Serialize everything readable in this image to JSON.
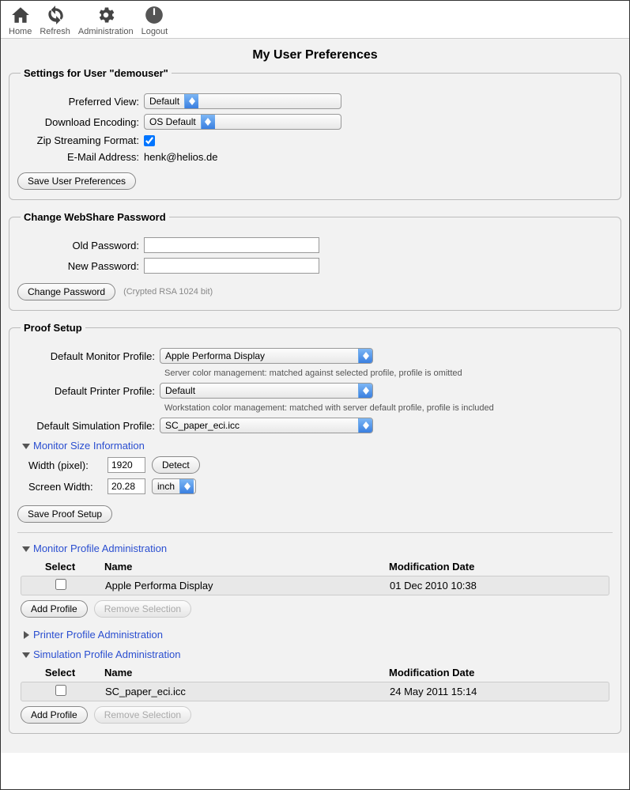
{
  "toolbar": {
    "home": "Home",
    "refresh": "Refresh",
    "administration": "Administration",
    "logout": "Logout"
  },
  "page_title": "My User Preferences",
  "settings": {
    "legend": "Settings for User \"demouser\"",
    "preferred_view_label": "Preferred View:",
    "preferred_view_value": "Default",
    "download_encoding_label": "Download Encoding:",
    "download_encoding_value": "OS Default",
    "zip_streaming_label": "Zip Streaming Format:",
    "email_label": "E-Mail Address:",
    "email_value": "henk@helios.de",
    "save_button": "Save User Preferences"
  },
  "password": {
    "legend": "Change WebShare Password",
    "old_label": "Old Password:",
    "new_label": "New Password:",
    "change_button": "Change Password",
    "enc_note": "(Crypted RSA 1024 bit)"
  },
  "proof": {
    "legend": "Proof Setup",
    "monitor_profile_label": "Default Monitor Profile:",
    "monitor_profile_value": "Apple Performa Display",
    "monitor_help": "Server color management: matched against selected profile, profile is omitted",
    "printer_profile_label": "Default Printer Profile:",
    "printer_profile_value": "Default",
    "printer_help": "Workstation color management: matched with server default profile, profile is included",
    "simulation_profile_label": "Default Simulation Profile:",
    "simulation_profile_value": "SC_paper_eci.icc",
    "monitor_size_title": "Monitor Size Information",
    "width_label": "Width (pixel):",
    "width_value": "1920",
    "detect_button": "Detect",
    "screen_width_label": "Screen Width:",
    "screen_width_value": "20.28",
    "screen_width_unit": "inch",
    "save_button": "Save Proof Setup",
    "monitor_admin_title": "Monitor Profile Administration",
    "printer_admin_title": "Printer Profile Administration",
    "simulation_admin_title": "Simulation Profile Administration",
    "col_select": "Select",
    "col_name": "Name",
    "col_date": "Modification Date",
    "monitor_row": {
      "name": "Apple Performa Display",
      "date": "01 Dec 2010 10:38"
    },
    "simulation_row": {
      "name": "SC_paper_eci.icc",
      "date": "24 May 2011 15:14"
    },
    "add_profile": "Add Profile",
    "remove_selection": "Remove Selection"
  }
}
